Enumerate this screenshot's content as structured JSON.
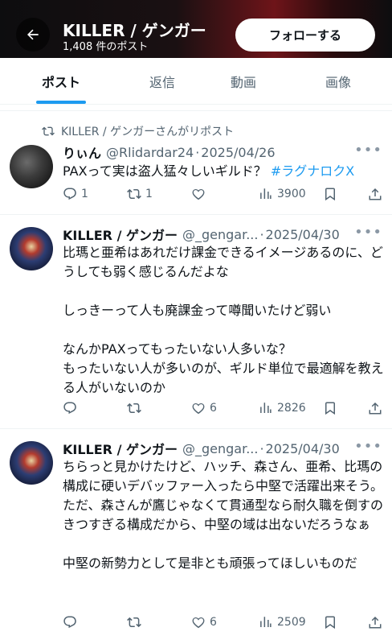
{
  "header": {
    "title": "KILLER / ゲンガー",
    "post_count": "1,408 件のポスト",
    "follow_label": "フォローする"
  },
  "tabs": [
    {
      "label": "ポスト",
      "active": true
    },
    {
      "label": "返信",
      "active": false
    },
    {
      "label": "動画",
      "active": false
    },
    {
      "label": "画像",
      "active": false
    }
  ],
  "posts": [
    {
      "repost_label": "KILLER / ゲンガーさんがリポスト",
      "display_name": "りぃん",
      "handle": "@Rlidardar24",
      "dot": "·",
      "date": "2025/04/26",
      "text": "PAXって実は盗人猛々しいギルド？ ",
      "hashtag": "#ラグナロクX",
      "replies": "1",
      "reposts": "1",
      "likes": "",
      "views": "3900"
    },
    {
      "display_name": "KILLER / ゲンガー",
      "handle": "@_gengar...",
      "dot": "·",
      "date": "2025/04/30",
      "text": "比瑪と亜希はあれだけ課金できるイメージあるのに、どうしても弱く感じるんだよな\n\nしっきーって人も廃課金って噂聞いたけど弱い\n\nなんかPAXってもったいない人多いな？\nもったいない人が多いのが、ギルド単位で最適解を教える人がいないのか",
      "replies": "",
      "reposts": "",
      "likes": "6",
      "views": "2826"
    },
    {
      "display_name": "KILLER / ゲンガー",
      "handle": "@_gengar...",
      "dot": "·",
      "date": "2025/04/30",
      "text": "ちらっと見かけたけど、ハッチ、森さん、亜希、比瑪の構成に硬いデバッファー入ったら中堅で活躍出来そう。\nただ、森さんが鷹じゃなくて貫通型なら耐久職を倒すのきつすぎる構成だから、中堅の域は出ないだろうなぁ\n\n中堅の新勢力として是非とも頑張ってほしいものだ",
      "replies": "",
      "reposts": "",
      "likes": "6",
      "views": "2509"
    }
  ],
  "colors": {
    "accent": "#1d9bf0",
    "text": "#0f1419",
    "secondary": "#536471"
  },
  "icons": [
    "back-arrow-icon",
    "repost-icon",
    "reply-icon",
    "like-icon",
    "views-icon",
    "bookmark-icon",
    "share-icon",
    "more-icon"
  ]
}
